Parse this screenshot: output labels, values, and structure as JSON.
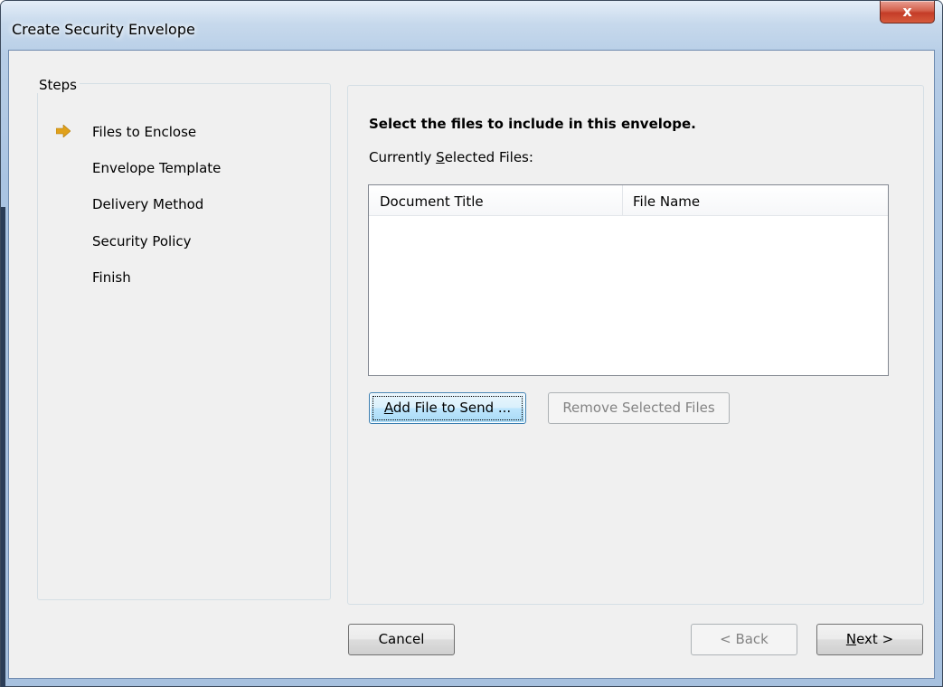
{
  "window": {
    "title": "Create Security Envelope",
    "close_label": "x"
  },
  "steps": {
    "legend": "Steps",
    "items": [
      {
        "label": "Files to Enclose",
        "current": true
      },
      {
        "label": "Envelope Template",
        "current": false
      },
      {
        "label": "Delivery Method",
        "current": false
      },
      {
        "label": "Security Policy",
        "current": false
      },
      {
        "label": "Finish",
        "current": false
      }
    ]
  },
  "content": {
    "instruction": "Select the files to include in this envelope.",
    "selected_label_pre": "Currently ",
    "selected_label_mnemonic": "S",
    "selected_label_post": "elected Files:",
    "columns": [
      "Document Title",
      "File Name"
    ],
    "rows": [],
    "add_button_mnemonic": "A",
    "add_button_rest": "dd File to Send ...",
    "remove_button": "Remove Selected Files"
  },
  "footer": {
    "cancel": "Cancel",
    "back": "< Back",
    "next_mnemonic": "N",
    "next_rest": "ext >"
  },
  "colors": {
    "step_arrow": "#e0a11b",
    "close_button": "#c43c27"
  },
  "icons": {
    "current_step": "right-arrow-icon",
    "close": "close-icon"
  }
}
